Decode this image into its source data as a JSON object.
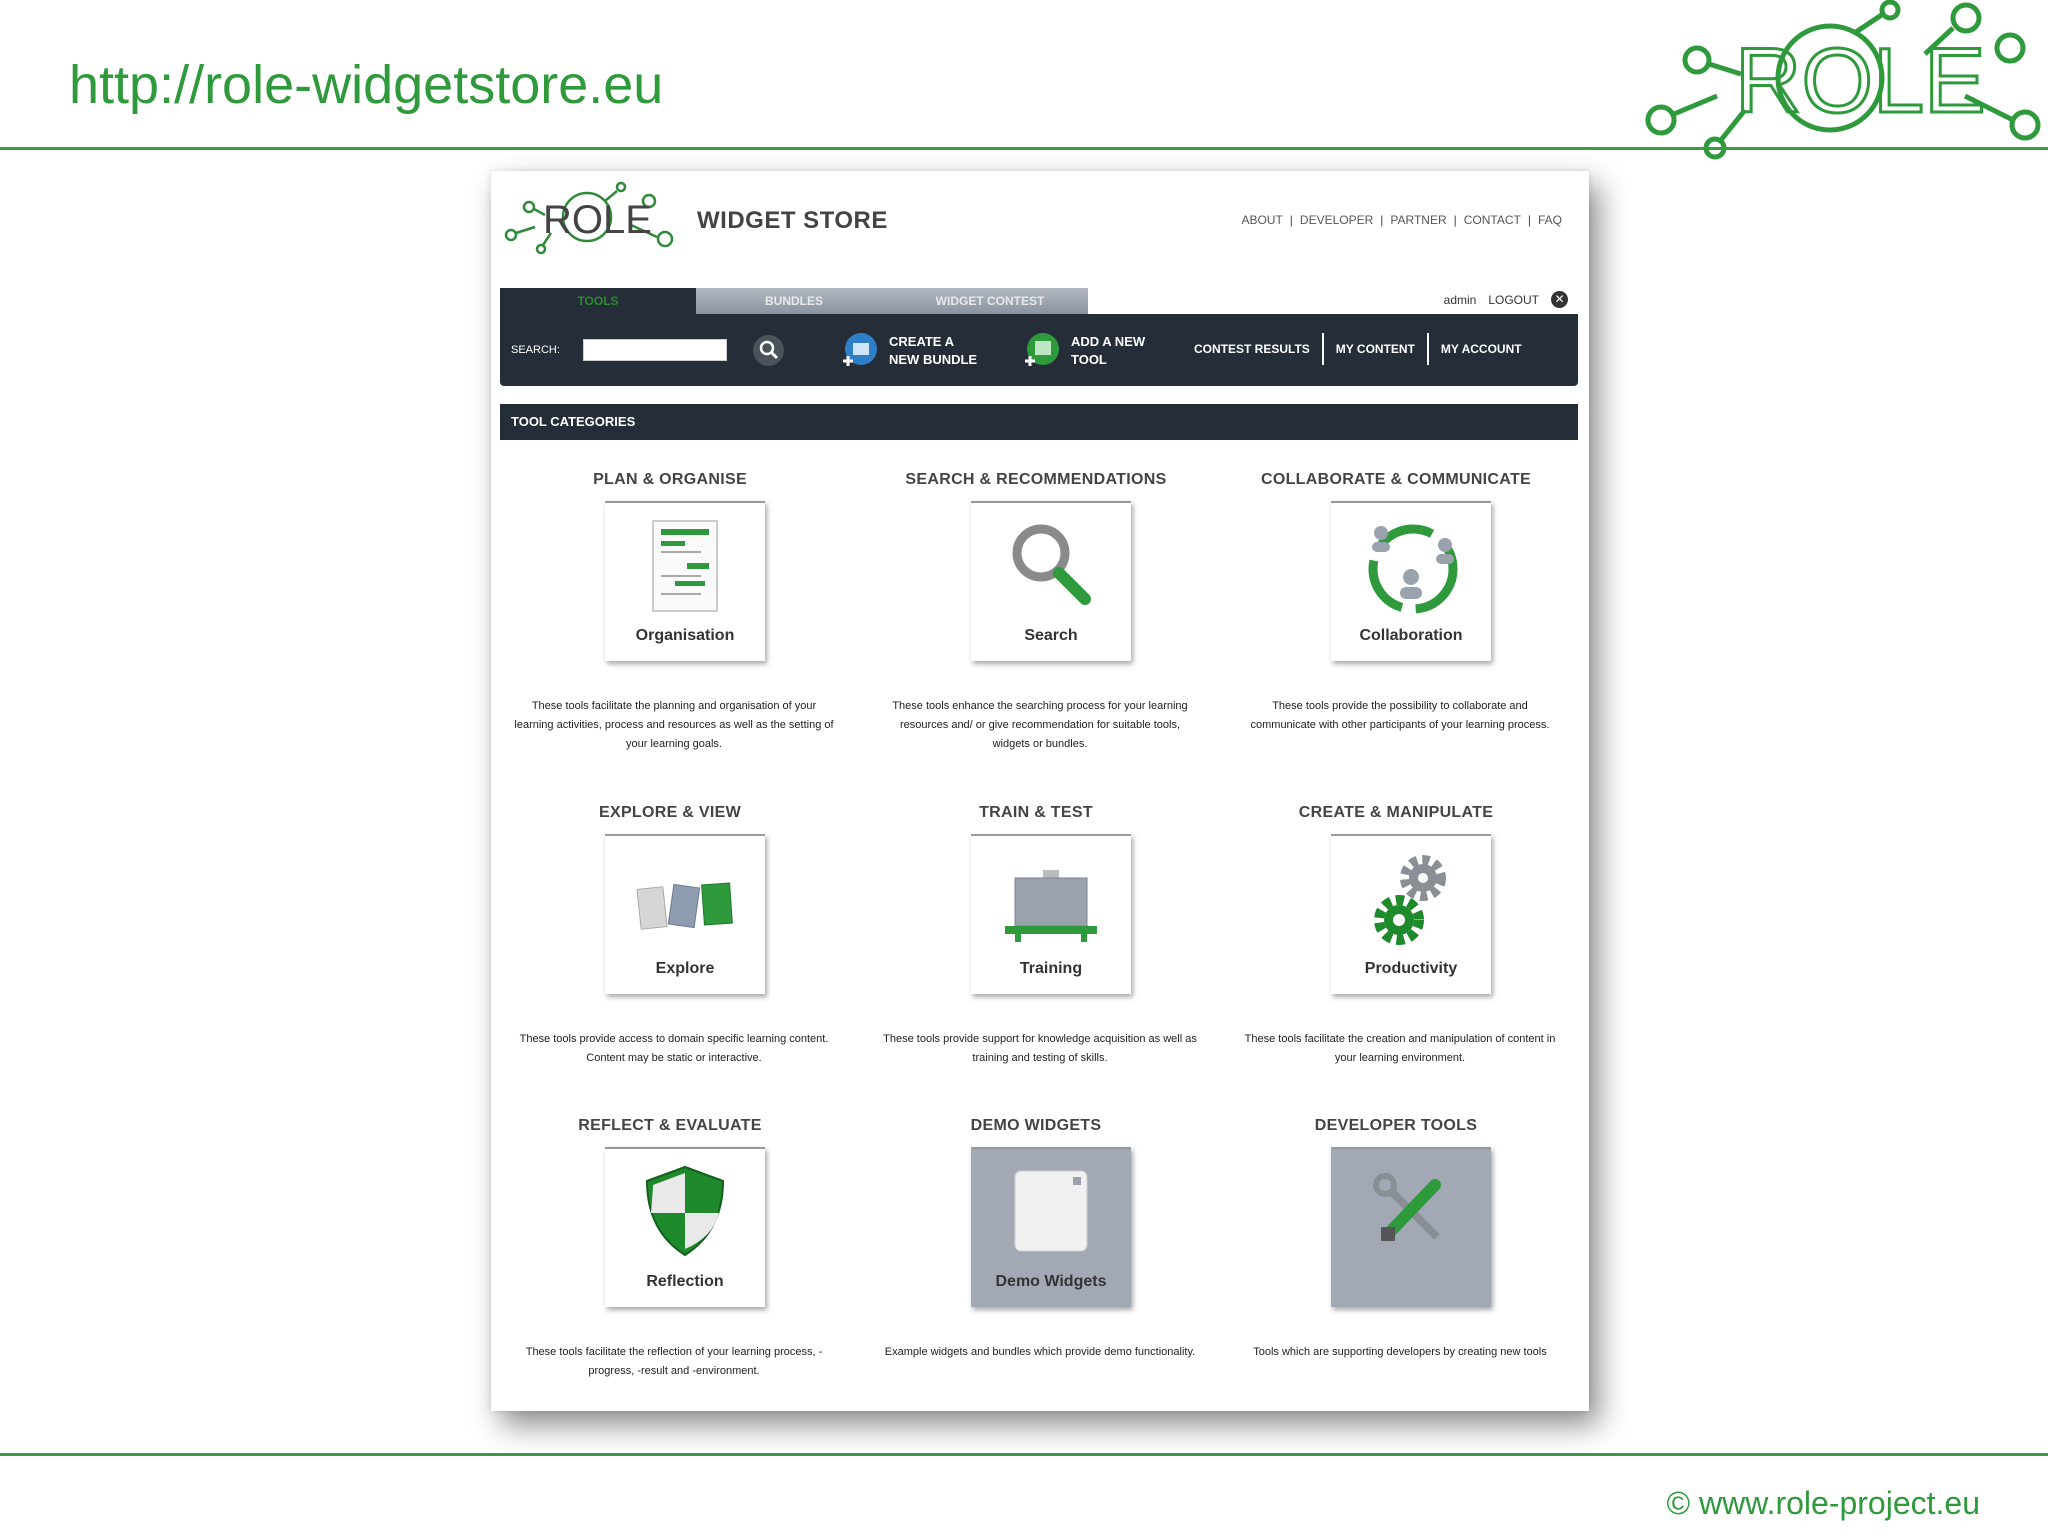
{
  "slide": {
    "url_title": "http://role-widgetstore.eu",
    "footer": "© www.role-project.eu",
    "logo_text": "ROLE"
  },
  "store": {
    "logo_text": "ROLE",
    "name": "WIDGET STORE",
    "top_nav": [
      "ABOUT",
      "DEVELOPER",
      "PARTNER",
      "CONTACT",
      "FAQ"
    ],
    "tabs": [
      "TOOLS",
      "BUNDLES",
      "WIDGET CONTEST"
    ],
    "user": "admin",
    "logout": "LOGOUT",
    "search_label": "SEARCH:",
    "search_value": "",
    "create_bundle": "CREATE A\nNEW BUNDLE",
    "add_tool": "ADD A NEW\nTOOL",
    "links": [
      "CONTEST RESULTS",
      "MY CONTENT",
      "MY ACCOUNT"
    ],
    "categories_label": "TOOL CATEGORIES"
  },
  "categories": [
    {
      "title": "PLAN & ORGANISE",
      "label": "Organisation",
      "desc": "These tools facilitate the planning and organisation of your learning activities, process and resources as well as the setting of your learning goals.",
      "icon": "organisation-icon"
    },
    {
      "title": "SEARCH & RECOMMENDATIONS",
      "label": "Search",
      "desc": "These tools enhance the searching process for your learning resources and/ or give recommendation for suitable tools, widgets or bundles.",
      "icon": "search-icon"
    },
    {
      "title": "COLLABORATE & COMMUNICATE",
      "label": "Collaboration",
      "desc": "These tools provide the possibility to collaborate and communicate with other participants of your learning process.",
      "icon": "collaboration-icon"
    },
    {
      "title": "EXPLORE & VIEW",
      "label": "Explore",
      "desc": "These tools provide access to domain specific learning content. Content may be static or interactive.",
      "icon": "explore-icon"
    },
    {
      "title": "TRAIN & TEST",
      "label": "Training",
      "desc": "These tools provide support for knowledge acquisition as well as training and testing of skills.",
      "icon": "training-icon"
    },
    {
      "title": "CREATE & MANIPULATE",
      "label": "Productivity",
      "desc": "These tools facilitate the creation and manipulation of content in your learning environment.",
      "icon": "productivity-icon"
    },
    {
      "title": "REFLECT & EVALUATE",
      "label": "Reflection",
      "desc": "These tools facilitate the reflection of your learning process, -progress, -result and -environment.",
      "icon": "reflection-icon"
    },
    {
      "title": "DEMO WIDGETS",
      "label": "Demo Widgets",
      "desc": "Example widgets and bundles which provide demo functionality.",
      "icon": "demo-widget-icon"
    },
    {
      "title": "DEVELOPER TOOLS",
      "label": "",
      "desc": "Tools which are supporting developers by creating new tools",
      "icon": "developer-tools-icon"
    }
  ],
  "colors": {
    "accent": "#2e9a3c",
    "dark_bar": "#252d38",
    "tab_inactive": "#9aa2ad"
  }
}
